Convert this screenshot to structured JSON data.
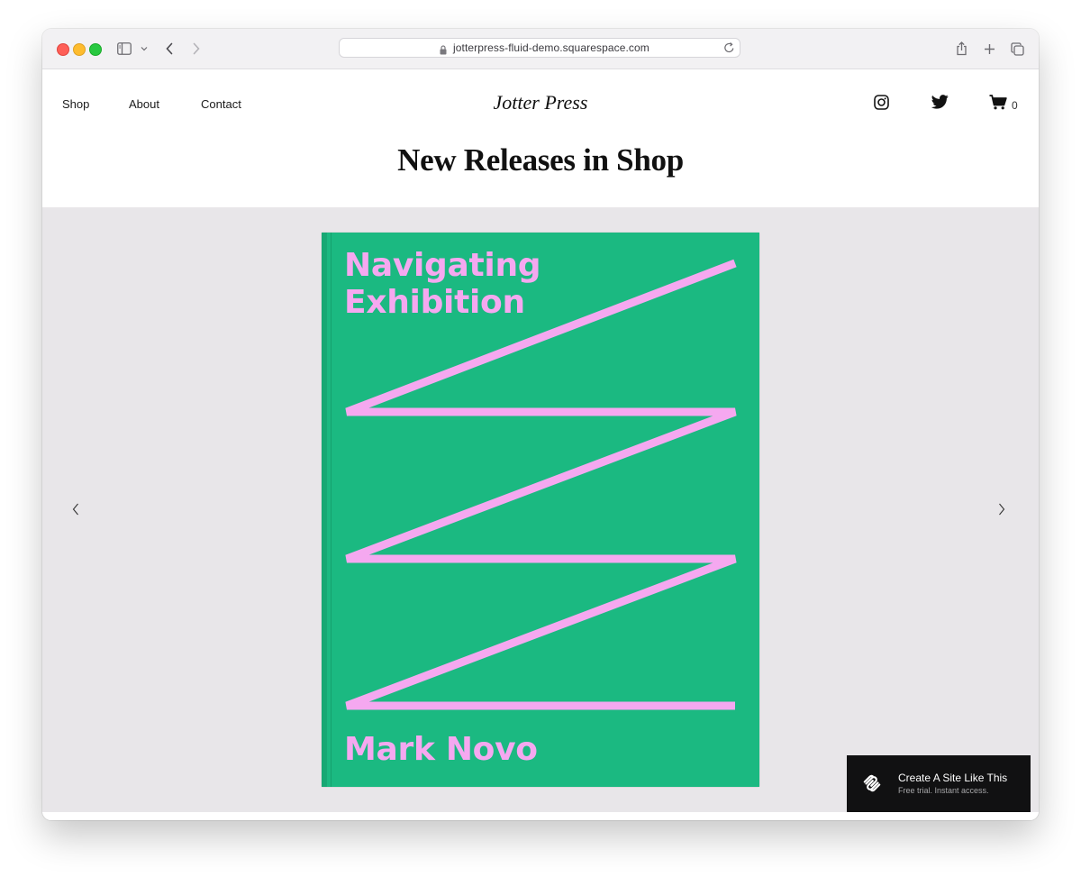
{
  "browser": {
    "url": "jotterpress-fluid-demo.squarespace.com"
  },
  "nav": {
    "items": [
      "Shop",
      "About",
      "Contact"
    ]
  },
  "brand": {
    "name": "Jotter Press"
  },
  "cart": {
    "count": "0"
  },
  "section": {
    "title": "New Releases in Shop"
  },
  "book": {
    "title_line1": "Navigating",
    "title_line2": "Exhibition",
    "author": "Mark Novo",
    "cover_color": "#1bb981",
    "accent_color": "#f5a8f0"
  },
  "badge": {
    "title": "Create A Site Like This",
    "subtitle": "Free trial. Instant access."
  },
  "icons": {
    "social": [
      "instagram-icon",
      "twitter-icon"
    ],
    "cart": "cart-icon",
    "slideshow": [
      "chevron-left-icon",
      "chevron-right-icon"
    ]
  }
}
